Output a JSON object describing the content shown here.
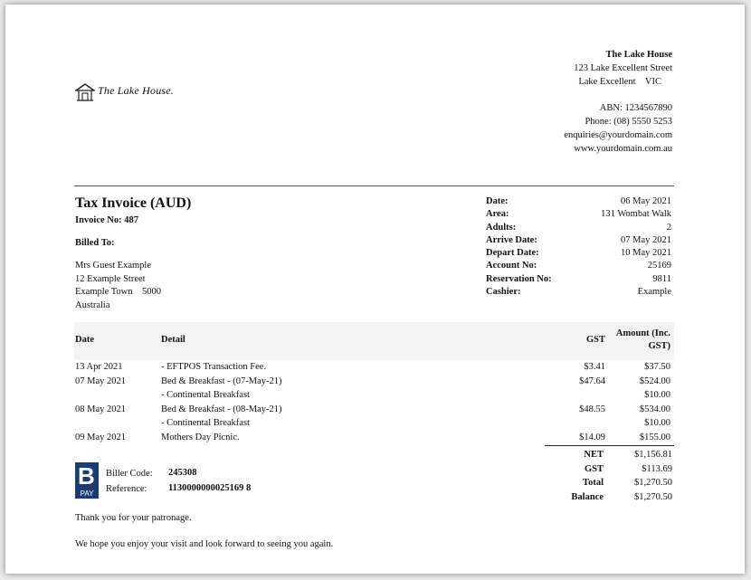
{
  "company": {
    "logo_text": "The Lake House.",
    "name": "The Lake House",
    "address1": "123 Lake Excellent Street",
    "address2": "Lake Excellent    VIC",
    "abn": "ABN: 1234567890",
    "phone": "Phone: (08) 5550 5253",
    "email": "enquiries@yourdomain.com",
    "website": "www.yourdomain.com.au"
  },
  "invoice": {
    "title": "Tax Invoice (AUD)",
    "number": "Invoice No: 487",
    "billed_label": "Billed To:",
    "billed_to": [
      "Mrs Guest Example",
      "12 Example Street",
      "Example Town    5000",
      "Australia"
    ]
  },
  "meta": [
    {
      "k": "Date:",
      "v": "06 May 2021"
    },
    {
      "k": "Area:",
      "v": "131 Wombat Walk"
    },
    {
      "k": "Adults:",
      "v": "2"
    },
    {
      "k": "Arrive Date:",
      "v": "07 May 2021"
    },
    {
      "k": "Depart Date:",
      "v": "10 May 2021"
    },
    {
      "k": "Account No:",
      "v": "25169"
    },
    {
      "k": "Reservation No:",
      "v": "9811"
    },
    {
      "k": "Cashier:",
      "v": "Example"
    }
  ],
  "table": {
    "headers": {
      "date": "Date",
      "detail": "Detail",
      "gst": "GST",
      "amount_line1": "Amount (Inc.",
      "amount_line2": "GST)"
    },
    "rows": [
      {
        "date": "13 Apr 2021",
        "detail": "- EFTPOS Transaction Fee.",
        "gst": "$3.41",
        "amount": "$37.50"
      },
      {
        "date": "07 May 2021",
        "detail": "Bed & Breakfast - (07-May-21)",
        "gst": "$47.64",
        "amount": "$524.00"
      },
      {
        "date": "",
        "detail": "- Continental Breakfast",
        "gst": "",
        "amount": "$10.00"
      },
      {
        "date": "08 May 2021",
        "detail": "Bed & Breakfast - (08-May-21)",
        "gst": "$48.55",
        "amount": "$534.00"
      },
      {
        "date": "",
        "detail": "- Continental Breakfast",
        "gst": "",
        "amount": "$10.00"
      },
      {
        "date": "09 May 2021",
        "detail": "Mothers Day Picnic.",
        "gst": "$14.09",
        "amount": "$155.00"
      }
    ]
  },
  "totals": [
    {
      "k": "NET",
      "v": "$1,156.81"
    },
    {
      "k": "GST",
      "v": "$113.69"
    },
    {
      "k": "Total",
      "v": "$1,270.50"
    },
    {
      "k": "Balance",
      "v": "$1,270.50"
    }
  ],
  "bpay": {
    "logo_letter": "B",
    "logo_word": "PAY",
    "biller_code_label": "Biller Code:",
    "reference_label": "Reference:",
    "biller_code": "245308",
    "reference": "1130000000025169 8"
  },
  "footer": {
    "thanks": "Thank you for your patronage.",
    "hope": "We hope you enjoy your visit and look forward to seeing you again."
  }
}
